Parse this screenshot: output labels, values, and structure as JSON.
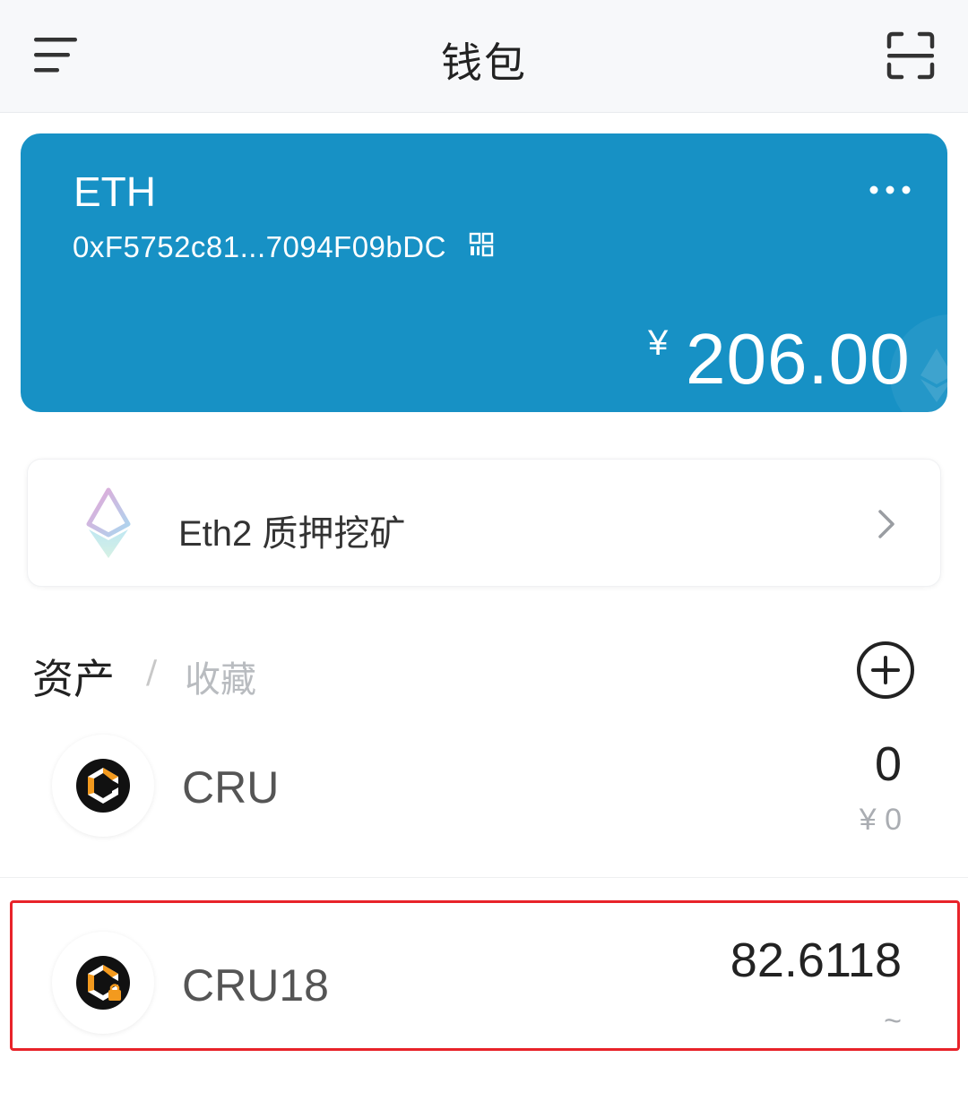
{
  "header": {
    "title": "钱包",
    "menu_icon": "hamburger-menu-icon",
    "scan_icon": "scan-icon"
  },
  "wallet": {
    "chain": "ETH",
    "address": "0xF5752c81...7094F09bDC",
    "currency_symbol": "¥",
    "balance": "206.00",
    "card_color": "#1791c5"
  },
  "staking": {
    "label": "Eth2 质押挖矿",
    "icon": "eth2-icon"
  },
  "tabs": {
    "assets": "资产",
    "separator": "/",
    "collectibles": "收藏"
  },
  "assets": [
    {
      "name": "CRU",
      "amount": "0",
      "fiat": "¥ 0"
    },
    {
      "name": "CRU18",
      "amount": "82.6118",
      "fiat": "~"
    }
  ],
  "colors": {
    "highlight": "#e8232a",
    "token_orange": "#f39a1e"
  }
}
